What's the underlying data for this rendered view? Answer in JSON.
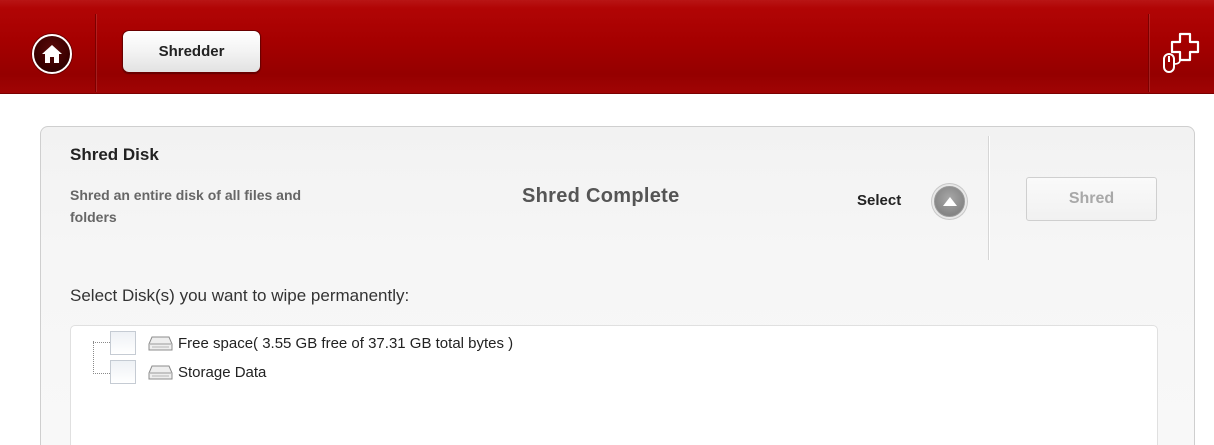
{
  "header": {
    "home_icon": "home-icon",
    "tab_label": "Shredder",
    "logo_icon": "puzzle-mouse-icon"
  },
  "shred_disk": {
    "title": "Shred Disk",
    "description": "Shred an entire disk of all files and folders",
    "status": "Shred Complete",
    "select_label": "Select",
    "select_icon": "collapse-up-icon",
    "shred_button": "Shred"
  },
  "disk_list": {
    "prompt": "Select Disk(s) you want to wipe permanently:",
    "items": [
      {
        "label": "Free space( 3.55 GB free of 37.31 GB total bytes )",
        "checked": false,
        "icon": "drive-icon"
      },
      {
        "label": "Storage Data",
        "checked": false,
        "icon": "drive-icon"
      }
    ]
  },
  "colors": {
    "header_red": "#a50000",
    "panel_bg": "#f5f5f5",
    "disabled_text": "#a8a8a8"
  }
}
